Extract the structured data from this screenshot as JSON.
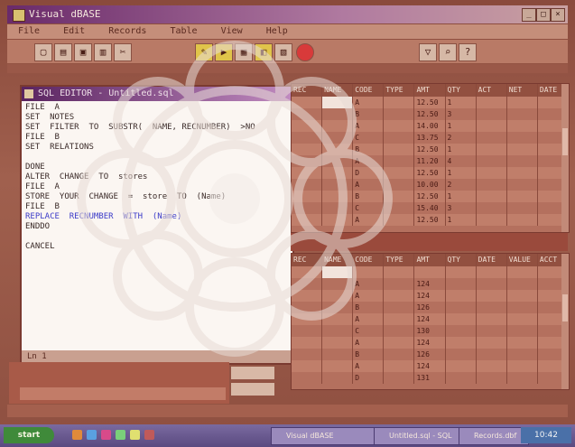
{
  "window": {
    "title": "Visual dBASE",
    "controls": [
      "_",
      "□",
      "×"
    ]
  },
  "menu": [
    "File",
    "Edit",
    "Records",
    "Table",
    "View",
    "Help"
  ],
  "editor": {
    "title": "SQL EDITOR - Untitled.sql",
    "lines": [
      {
        "text": "FILE  A",
        "blue": false
      },
      {
        "text": "SET  NOTES",
        "blue": false
      },
      {
        "text": "SET  FILTER  TO  SUBSTR(  NAME, RECNUMBER)  >NO",
        "blue": false
      },
      {
        "text": "FILE  B",
        "blue": false
      },
      {
        "text": "SET  RELATIONS",
        "blue": false
      },
      {
        "text": "",
        "blue": false
      },
      {
        "text": "DONE",
        "blue": false
      },
      {
        "text": "ALTER  CHANGE  TO  stores",
        "blue": false
      },
      {
        "text": "FILE  A",
        "blue": false
      },
      {
        "text": "STORE  YOUR  CHANGE  =  store  TO  (Name)",
        "blue": false
      },
      {
        "text": "FILE  B",
        "blue": false
      },
      {
        "text": "REPLACE  RECNUMBER  WITH  (Name)",
        "blue": true
      },
      {
        "text": "ENDDO",
        "blue": false
      },
      {
        "text": "",
        "blue": false
      },
      {
        "text": "CANCEL",
        "blue": false
      }
    ],
    "status": "Ln 1"
  },
  "upper_grid": {
    "headers": [
      "REC",
      "NAME",
      "CODE",
      "TYPE",
      "AMT",
      "QTY",
      "ACT",
      "NET",
      "DATE"
    ],
    "rows": [
      [
        "",
        "",
        "A",
        "",
        "12.50",
        "1",
        "",
        "",
        ""
      ],
      [
        "",
        "",
        "B",
        "",
        "12.50",
        "3",
        "",
        "",
        ""
      ],
      [
        "",
        "",
        "A",
        "",
        "14.00",
        "1",
        "",
        "",
        ""
      ],
      [
        "",
        "",
        "C",
        "",
        "13.75",
        "2",
        "",
        "",
        ""
      ],
      [
        "",
        "",
        "B",
        "",
        "12.50",
        "1",
        "",
        "",
        ""
      ],
      [
        "",
        "",
        "A",
        "",
        "11.20",
        "4",
        "",
        "",
        ""
      ],
      [
        "",
        "",
        "D",
        "",
        "12.50",
        "1",
        "",
        "",
        ""
      ],
      [
        "",
        "",
        "A",
        "",
        "10.00",
        "2",
        "",
        "",
        ""
      ],
      [
        "",
        "",
        "B",
        "",
        "12.50",
        "1",
        "",
        "",
        ""
      ],
      [
        "",
        "",
        "C",
        "",
        "15.40",
        "3",
        "",
        "",
        ""
      ],
      [
        "",
        "",
        "A",
        "",
        "12.50",
        "1",
        "",
        "",
        ""
      ]
    ]
  },
  "lower_grid": {
    "headers": [
      "REC",
      "NAME",
      "CODE",
      "TYPE",
      "AMT",
      "QTY",
      "DATE",
      "VALUE",
      "ACCT"
    ],
    "rows": [
      [
        "",
        "",
        "",
        "",
        "",
        "",
        "",
        "",
        ""
      ],
      [
        "",
        "",
        "A",
        "",
        "124",
        "",
        "",
        "",
        ""
      ],
      [
        "",
        "",
        "A",
        "",
        "124",
        "",
        "",
        "",
        ""
      ],
      [
        "",
        "",
        "B",
        "",
        "126",
        "",
        "",
        "",
        ""
      ],
      [
        "",
        "",
        "A",
        "",
        "124",
        "",
        "",
        "",
        ""
      ],
      [
        "",
        "",
        "C",
        "",
        "130",
        "",
        "",
        "",
        ""
      ],
      [
        "",
        "",
        "A",
        "",
        "124",
        "",
        "",
        "",
        ""
      ],
      [
        "",
        "",
        "B",
        "",
        "126",
        "",
        "",
        "",
        ""
      ],
      [
        "",
        "",
        "A",
        "",
        "124",
        "",
        "",
        "",
        ""
      ],
      [
        "",
        "",
        "D",
        "",
        "131",
        "",
        "",
        "",
        ""
      ]
    ]
  },
  "taskbar": {
    "start_label": "start",
    "tasks": [
      "Visual dBASE",
      "Untitled.sql - SQL",
      "Records.dbf"
    ],
    "clock": "10:42"
  },
  "colors": {
    "tint": "#a0604e",
    "titlebar_start": "#6a2a6a",
    "editor_bg": "#fbf6f2",
    "accent_red": "#d83a3a"
  }
}
